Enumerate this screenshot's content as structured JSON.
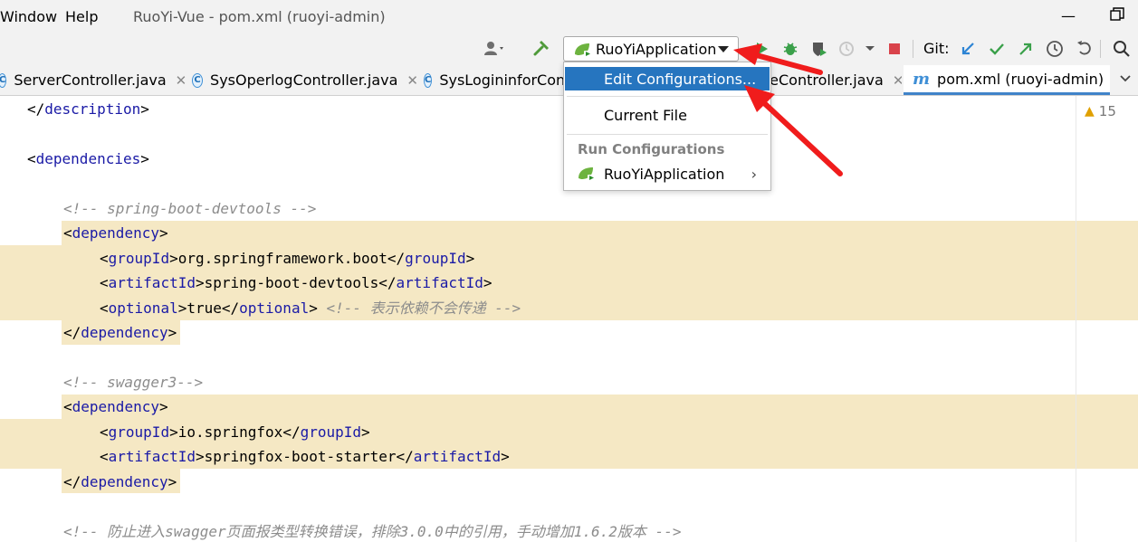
{
  "menu": {
    "window_label": "Window",
    "help_label": "Help"
  },
  "window_title": "RuoYi-Vue - pom.xml (ruoyi-admin)",
  "toolbar": {
    "run_config": "RuoYiApplication",
    "git_label": "Git:"
  },
  "tabs": [
    {
      "label": "ServerController.java",
      "icon": "class-icon"
    },
    {
      "label": "SysOperlogController.java",
      "icon": "class-icon"
    },
    {
      "label": "SysLogininforCont",
      "icon": "class-icon"
    },
    {
      "label": "neController.java",
      "icon": "class-icon"
    },
    {
      "label": "pom.xml (ruoyi-admin)",
      "icon": "maven-icon",
      "active": true
    }
  ],
  "editor": {
    "warning_count": "15",
    "lines": {
      "l1": {
        "open": "</",
        "tag": "description",
        "close": ">"
      },
      "l3": {
        "open": "<",
        "tag": "dependencies",
        "close": ">"
      },
      "l5": "<!-- spring-boot-devtools -->",
      "l6": {
        "open": "<",
        "tag": "dependency",
        "close": ">"
      },
      "l7": {
        "tag": "groupId",
        "value": "org.springframework.boot"
      },
      "l8": {
        "tag": "artifactId",
        "value": "spring-boot-devtools"
      },
      "l9": {
        "tag": "optional",
        "value": "true",
        "comment": "<!-- 表示依赖不会传递 -->"
      },
      "l10": {
        "open": "</",
        "tag": "dependency",
        "close": ">"
      },
      "l12": "<!-- swagger3-->",
      "l13": {
        "open": "<",
        "tag": "dependency",
        "close": ">"
      },
      "l14": {
        "tag": "groupId",
        "value": "io.springfox"
      },
      "l15": {
        "tag": "artifactId",
        "value": "springfox-boot-starter"
      },
      "l16": {
        "open": "</",
        "tag": "dependency",
        "close": ">"
      },
      "l18": "<!-- 防止进入swagger页面报类型转换错误，排除3.0.0中的引用，手动增加1.6.2版本 -->"
    }
  },
  "popup": {
    "edit_configurations": "Edit Configurations...",
    "current_file": "Current File",
    "run_configurations_header": "Run Configurations",
    "run_item": "RuoYiApplication"
  },
  "colors": {
    "accent": "#2675bf",
    "highlight": "#f5e8c4",
    "xml_tag": "#1a1aa6",
    "annotation_arrow": "#f01c1c"
  }
}
